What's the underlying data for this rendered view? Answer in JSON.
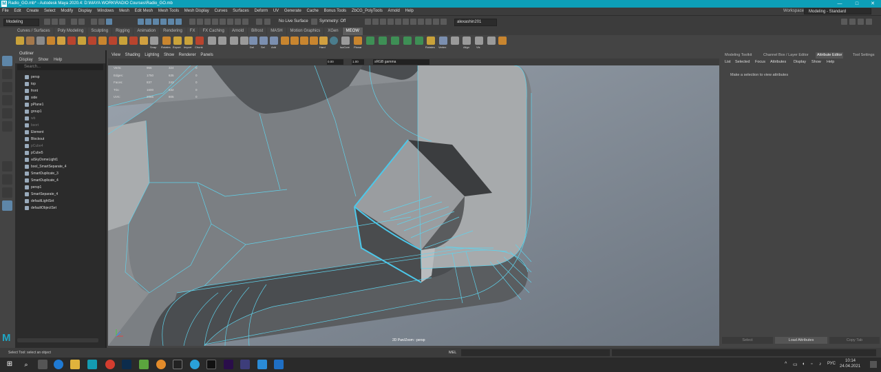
{
  "window": {
    "title": "Radio_GO.mb* - Autodesk Maya 2020.4: D:\\MAYA WORK\\RADIO Courses\\Radio_GO.mb",
    "logo": "M",
    "controls": [
      "—",
      "□",
      "✕"
    ]
  },
  "menubar": [
    "File",
    "Edit",
    "Create",
    "Select",
    "Modify",
    "Display",
    "Windows",
    "Mesh",
    "Edit Mesh",
    "Mesh Tools",
    "Mesh Display",
    "Curves",
    "Surfaces",
    "Deform",
    "UV",
    "Generate",
    "Cache",
    "Bonus Tools",
    "ZbCG_PolyTools",
    "Arnold",
    "Help"
  ],
  "workspace": {
    "label": "Workspace:",
    "value": "Modeling - Standard"
  },
  "statusline": {
    "mode": "Modeling",
    "live_surface": "No Live Surface",
    "symmetry": "Symmetry: Off",
    "user": "alexashin201"
  },
  "shelf_tabs": [
    "Curves / Surfaces",
    "Poly Modeling",
    "Sculpting",
    "Rigging",
    "Animation",
    "Rendering",
    "FX",
    "FX Caching",
    "Arnold",
    "Bifrost",
    "MASH",
    "Motion Graphics",
    "XGen",
    "MEOW"
  ],
  "shelf_active": "MEOW",
  "shelf_icon_labels": [
    "Snap",
    "Rotates",
    "Export",
    "Import",
    "Chunk",
    "Del",
    "Sel",
    "Add",
    "Rings",
    "Hard",
    "IsoCore",
    "Planar",
    "Symmetry",
    "Rotates",
    "Vertex",
    "Align",
    "Vis"
  ],
  "outliner": {
    "title": "Outliner",
    "menu": [
      "Display",
      "Show",
      "Help"
    ],
    "search_placeholder": "Search...",
    "items": [
      {
        "label": "persp",
        "dim": false
      },
      {
        "label": "top",
        "dim": false
      },
      {
        "label": "front",
        "dim": false
      },
      {
        "label": "side",
        "dim": false
      },
      {
        "label": "pPlane1",
        "dim": false
      },
      {
        "label": "group1",
        "dim": false
      },
      {
        "label": "wb",
        "dim": true
      },
      {
        "label": "bsort",
        "dim": true
      },
      {
        "label": "Element",
        "dim": false
      },
      {
        "label": "Blockout",
        "dim": false
      },
      {
        "label": "pCube4",
        "dim": true
      },
      {
        "label": "pCube5",
        "dim": false
      },
      {
        "label": "aiSkyDomeLight1",
        "dim": false
      },
      {
        "label": "bool_SmartSeparate_4",
        "dim": false
      },
      {
        "label": "SmartDuplicate_3",
        "dim": false
      },
      {
        "label": "SmartDuplicate_4",
        "dim": false
      },
      {
        "label": "persp1",
        "dim": false
      },
      {
        "label": "SmartSeparate_4",
        "dim": false
      },
      {
        "label": "defaultLightSet",
        "dim": false
      },
      {
        "label": "defaultObjectSet",
        "dim": false
      }
    ]
  },
  "viewport": {
    "menu": [
      "View",
      "Shading",
      "Lighting",
      "Show",
      "Renderer",
      "Panels"
    ],
    "field_a": "0.00",
    "field_b": "1.00",
    "colorspace": "sRGB gamma",
    "label": "2D Pan/Zoom : persp",
    "hud": [
      {
        "name": "Verts:",
        "a": "956",
        "b": "324",
        "c": "0"
      },
      {
        "name": "Edges:",
        "a": "1750",
        "b": "635",
        "c": "0"
      },
      {
        "name": "Faces:",
        "a": "837",
        "b": "243",
        "c": "0"
      },
      {
        "name": "Tris:",
        "a": "1600",
        "b": "632",
        "c": "0"
      },
      {
        "name": "UVs:",
        "a": "2065",
        "b": "805",
        "c": "0"
      }
    ]
  },
  "right_panel": {
    "tabs": [
      "Modeling Toolkit",
      "Channel Box / Layer Editor",
      "Attribute Editor",
      "Tool Settings"
    ],
    "active_tab": "Attribute Editor",
    "menu": [
      "List",
      "Selected",
      "Focus",
      "Attributes",
      "Display",
      "Show",
      "Help"
    ],
    "message": "Make a selection to view attributes",
    "buttons": [
      "Select",
      "Load Attributes",
      "Copy Tab"
    ]
  },
  "command_line": {
    "lang": "MEL"
  },
  "help_line": "Select Tool: select an object",
  "taskbar": {
    "lang": "РУС",
    "time": "10:14",
    "date": "24.04.2021"
  }
}
